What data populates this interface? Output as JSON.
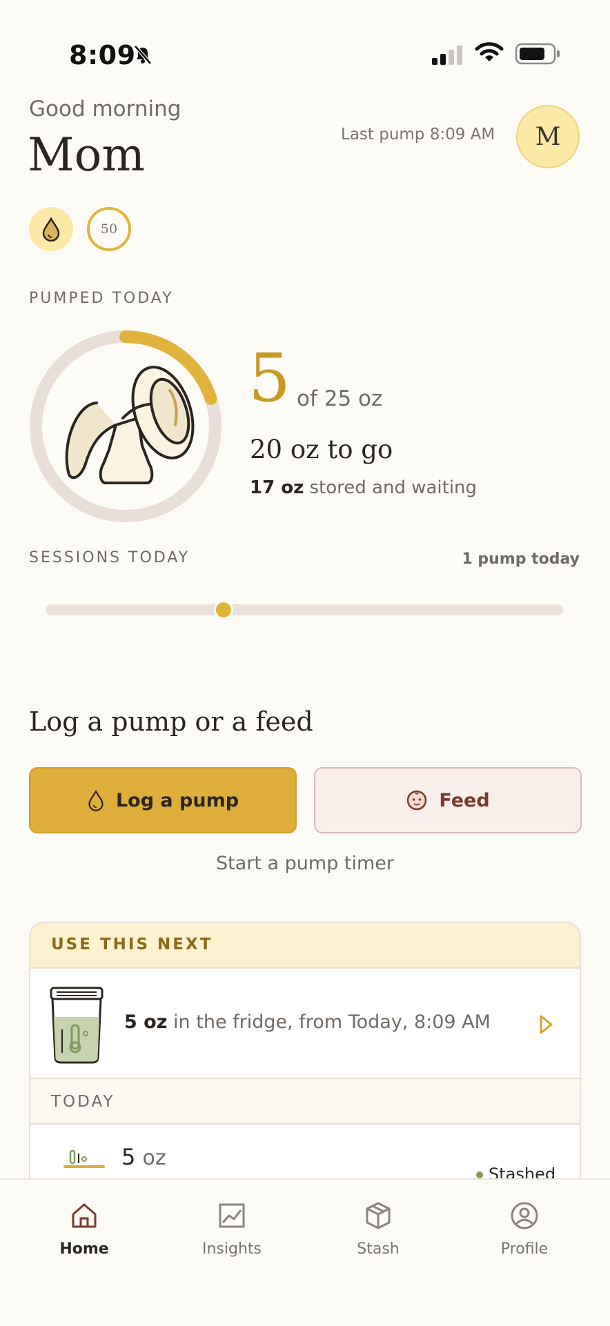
{
  "status_bar": {
    "time": "8:09"
  },
  "header": {
    "greeting": "Good morning",
    "name": "Mom",
    "last_pump": "Last pump 8:09 AM",
    "avatar_initial": "M",
    "badge_count": "50"
  },
  "pumped_today": {
    "label": "PUMPED TODAY",
    "amount": "5",
    "goal_text": "of 25 oz",
    "remaining_text": "20 oz to go",
    "stored_amount": "17 oz",
    "stored_text": "stored and waiting",
    "progress_fraction": 0.2
  },
  "sessions": {
    "label": "SESSIONS TODAY",
    "count_text": "1 pump today"
  },
  "log": {
    "title": "Log a pump or a feed",
    "pump_button": "Log a pump",
    "feed_button": "Feed",
    "timer_link": "Start a pump timer"
  },
  "use_next": {
    "label": "USE THIS NEXT",
    "amount": "5 oz",
    "detail": "in the fridge, from Today, 8:09 AM"
  },
  "today": {
    "label": "TODAY",
    "entry_amount": "5",
    "entry_unit": "oz",
    "entry_status": "Stashed"
  },
  "nav": {
    "items": [
      {
        "label": "Home",
        "icon": "home-icon"
      },
      {
        "label": "Insights",
        "icon": "insights-icon"
      },
      {
        "label": "Stash",
        "icon": "stash-icon"
      },
      {
        "label": "Profile",
        "icon": "profile-icon"
      }
    ]
  },
  "colors": {
    "accent": "#DEAE3A",
    "background": "#FDFBF6",
    "avatar_bg": "#FCE9A7",
    "feed_text": "#7a3a2c"
  }
}
